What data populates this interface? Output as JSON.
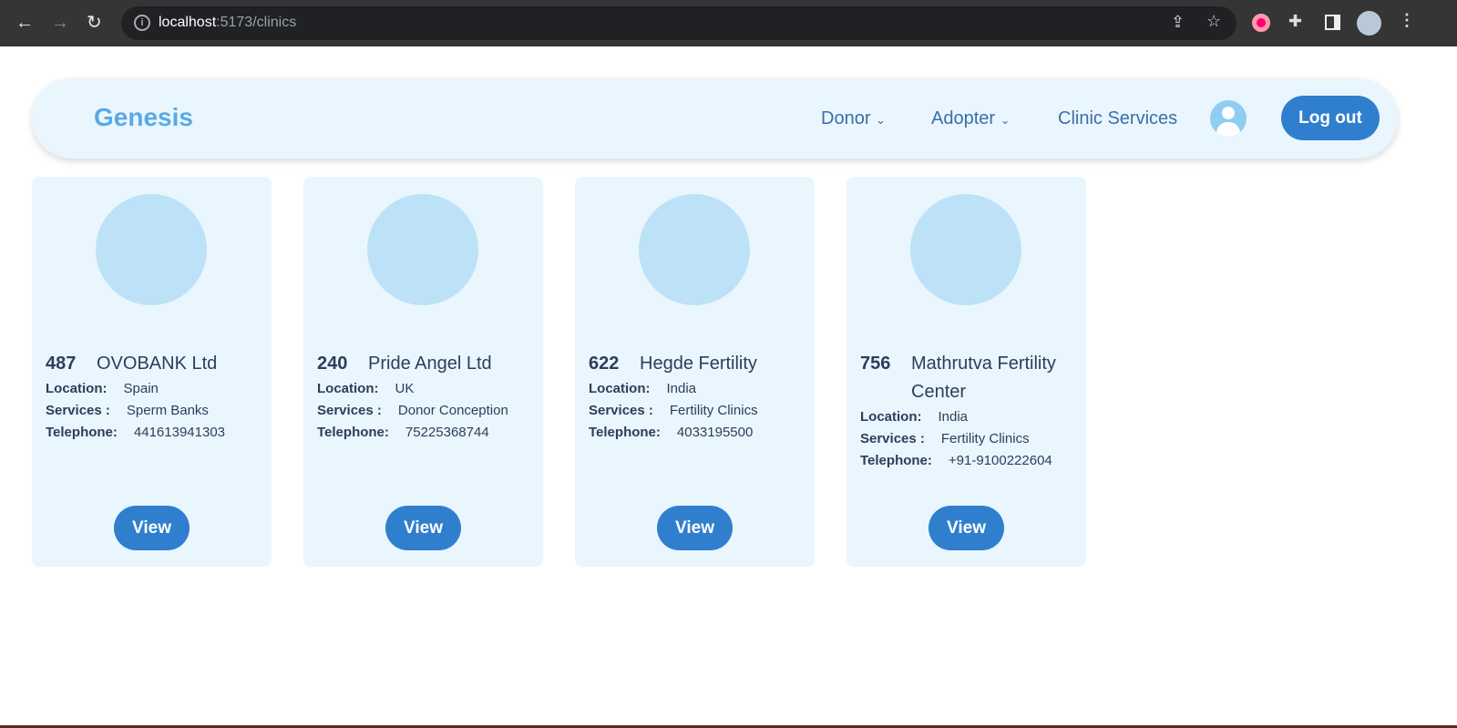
{
  "browser": {
    "url_host": "localhost",
    "url_path": ":5173/clinics"
  },
  "nav": {
    "logo": "Genesis",
    "items": [
      {
        "label": "Donor",
        "dropdown": true
      },
      {
        "label": "Adopter",
        "dropdown": true
      },
      {
        "label": "Clinic Services",
        "dropdown": false
      }
    ],
    "logout": "Log out"
  },
  "labels": {
    "location": "Location:",
    "services": "Services :",
    "telephone": "Telephone:",
    "view": "View"
  },
  "clinics": [
    {
      "id": "487",
      "name": "OVOBANK Ltd",
      "location": "Spain",
      "services": "Sperm Banks",
      "telephone": "441613941303"
    },
    {
      "id": "240",
      "name": "Pride Angel Ltd",
      "location": "UK",
      "services": "Donor Conception",
      "telephone": "75225368744"
    },
    {
      "id": "622",
      "name": "Hegde Fertility",
      "location": "India",
      "services": "Fertility Clinics",
      "telephone": "4033195500"
    },
    {
      "id": "756",
      "name": "Mathrutva Fertility Center",
      "location": "India",
      "services": "Fertility Clinics",
      "telephone": "+91-9100222604"
    }
  ],
  "colors": {
    "accent": "#2f7fce",
    "logo": "#5aa9e6",
    "card_bg": "#e9f6fe"
  }
}
